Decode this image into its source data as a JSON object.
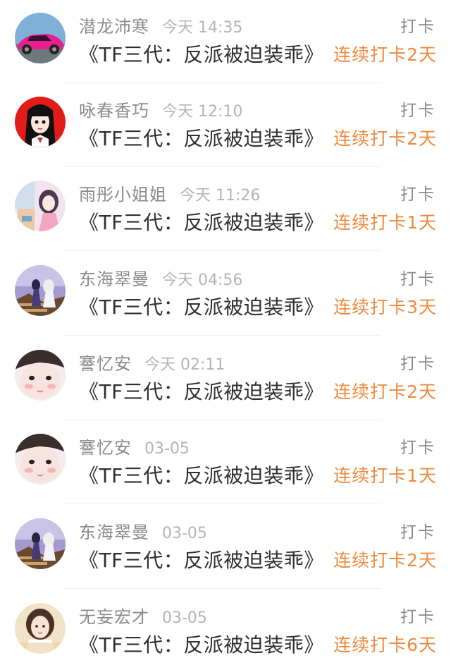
{
  "colors": {
    "accent": "#f08a3c",
    "username": "#8a8a8a",
    "time": "#b4b4b4",
    "topic": "#2f2f2f",
    "divider": "#eeeeee"
  },
  "checkins": [
    {
      "username": "潜龙沛寒",
      "time": "今天 14:35",
      "action": "打卡",
      "topic": "《TF三代：反派被迫装乖》",
      "streak": "连续打卡2天",
      "avatar": "pink-sports-car"
    },
    {
      "username": "咏春香巧",
      "time": "今天 12:10",
      "action": "打卡",
      "topic": "《TF三代：反派被迫装乖》",
      "streak": "连续打卡2天",
      "avatar": "anime-girl-red"
    },
    {
      "username": "雨彤小姐姐",
      "time": "今天 11:26",
      "action": "打卡",
      "topic": "《TF三代：反派被迫装乖》",
      "streak": "连续打卡1天",
      "avatar": "anime-girl-pastel"
    },
    {
      "username": "东海翠曼",
      "time": "今天 04:56",
      "action": "打卡",
      "topic": "《TF三代：反派被迫装乖》",
      "streak": "连续打卡3天",
      "avatar": "fantasy-scene"
    },
    {
      "username": "謇忆安",
      "time": "今天 02:11",
      "action": "打卡",
      "topic": "《TF三代：反派被迫装乖》",
      "streak": "连续打卡2天",
      "avatar": "girl-face-closeup"
    },
    {
      "username": "謇忆安",
      "time": "03-05",
      "action": "打卡",
      "topic": "《TF三代：反派被迫装乖》",
      "streak": "连续打卡1天",
      "avatar": "girl-face-closeup"
    },
    {
      "username": "东海翠曼",
      "time": "03-05",
      "action": "打卡",
      "topic": "《TF三代：反派被迫装乖》",
      "streak": "连续打卡2天",
      "avatar": "fantasy-scene"
    },
    {
      "username": "无妄宏才",
      "time": "03-05",
      "action": "打卡",
      "topic": "《TF三代：反派被迫装乖》",
      "streak": "连续打卡6天",
      "avatar": "girl-portrait"
    }
  ]
}
